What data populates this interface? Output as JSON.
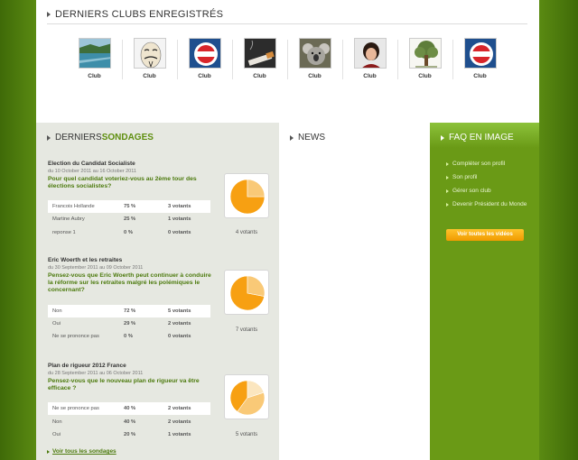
{
  "clubs": {
    "title": "DERNIERS CLUBS ENREGISTRÉS",
    "items": [
      {
        "label": "Club",
        "icon": "lake-photo-icon"
      },
      {
        "label": "Club",
        "icon": "anonymous-mask-icon"
      },
      {
        "label": "Club",
        "icon": "ps-logo-icon"
      },
      {
        "label": "Club",
        "icon": "cigarette-photo-icon"
      },
      {
        "label": "Club",
        "icon": "koala-photo-icon"
      },
      {
        "label": "Club",
        "icon": "person-photo-icon"
      },
      {
        "label": "Club",
        "icon": "tree-photo-icon"
      },
      {
        "label": "Club",
        "icon": "ps-logo-icon"
      }
    ]
  },
  "sondages": {
    "title_prefix": "DERNIERS ",
    "title_highlight": "SONDAGES",
    "see_all": "Voir tous les sondages",
    "polls": [
      {
        "title": "Election du Candidat Socialiste",
        "date": "du 10 October 2011 au 16 October 2011",
        "question": "Pour quel candidat voteriez-vous au 2ème tour des élections socialistes?",
        "answers": [
          {
            "label": "Francois Hollande",
            "pct": "75 %",
            "votes": "3 votants",
            "value": 75
          },
          {
            "label": "Martine Aubry",
            "pct": "25 %",
            "votes": "1 votants",
            "value": 25
          },
          {
            "label": "reponse 1",
            "pct": "0 %",
            "votes": "0 votants",
            "value": 0
          }
        ],
        "total": "4 votants"
      },
      {
        "title": "Eric Woerth et les retraites",
        "date": "du 30 September 2011 au 09 October 2011",
        "question": "Pensez-vous que Eric Woerth peut continuer à conduire la réforme sur les retraites malgré les polémiques le concernant?",
        "answers": [
          {
            "label": "Non",
            "pct": "72 %",
            "votes": "5 votants",
            "value": 72
          },
          {
            "label": "Oui",
            "pct": "29 %",
            "votes": "2 votants",
            "value": 28
          },
          {
            "label": "Ne se prononce pas",
            "pct": "0 %",
            "votes": "0 votants",
            "value": 0
          }
        ],
        "total": "7 votants"
      },
      {
        "title": "Plan de rigueur 2012 France",
        "date": "du 28 September 2011 au 06 October 2011",
        "question": "Pensez-vous que le nouveau plan de rigueur va être efficace ?",
        "answers": [
          {
            "label": "Ne se prononce pas",
            "pct": "40 %",
            "votes": "2 votants",
            "value": 40
          },
          {
            "label": "Non",
            "pct": "40 %",
            "votes": "2 votants",
            "value": 40
          },
          {
            "label": "Oui",
            "pct": "20 %",
            "votes": "1 votants",
            "value": 20
          }
        ],
        "total": "5 votants"
      }
    ]
  },
  "news": {
    "title": "NEWS"
  },
  "faq": {
    "title": "FAQ EN IMAGE",
    "links": [
      "Compléter son profil",
      "Son profil",
      "Gérer son club",
      "Devenir Président du Monde"
    ],
    "button": "Voir toutes les vidéos"
  },
  "colors": {
    "background_green": "#4f7d0a",
    "accent_green": "#5e8e0e",
    "faq_green": "#6a9a16",
    "pie_orange": "#f7a012",
    "pie_light": "#f9c977",
    "pie_pale": "#fbe6bf",
    "button_orange": "#f5a300"
  }
}
